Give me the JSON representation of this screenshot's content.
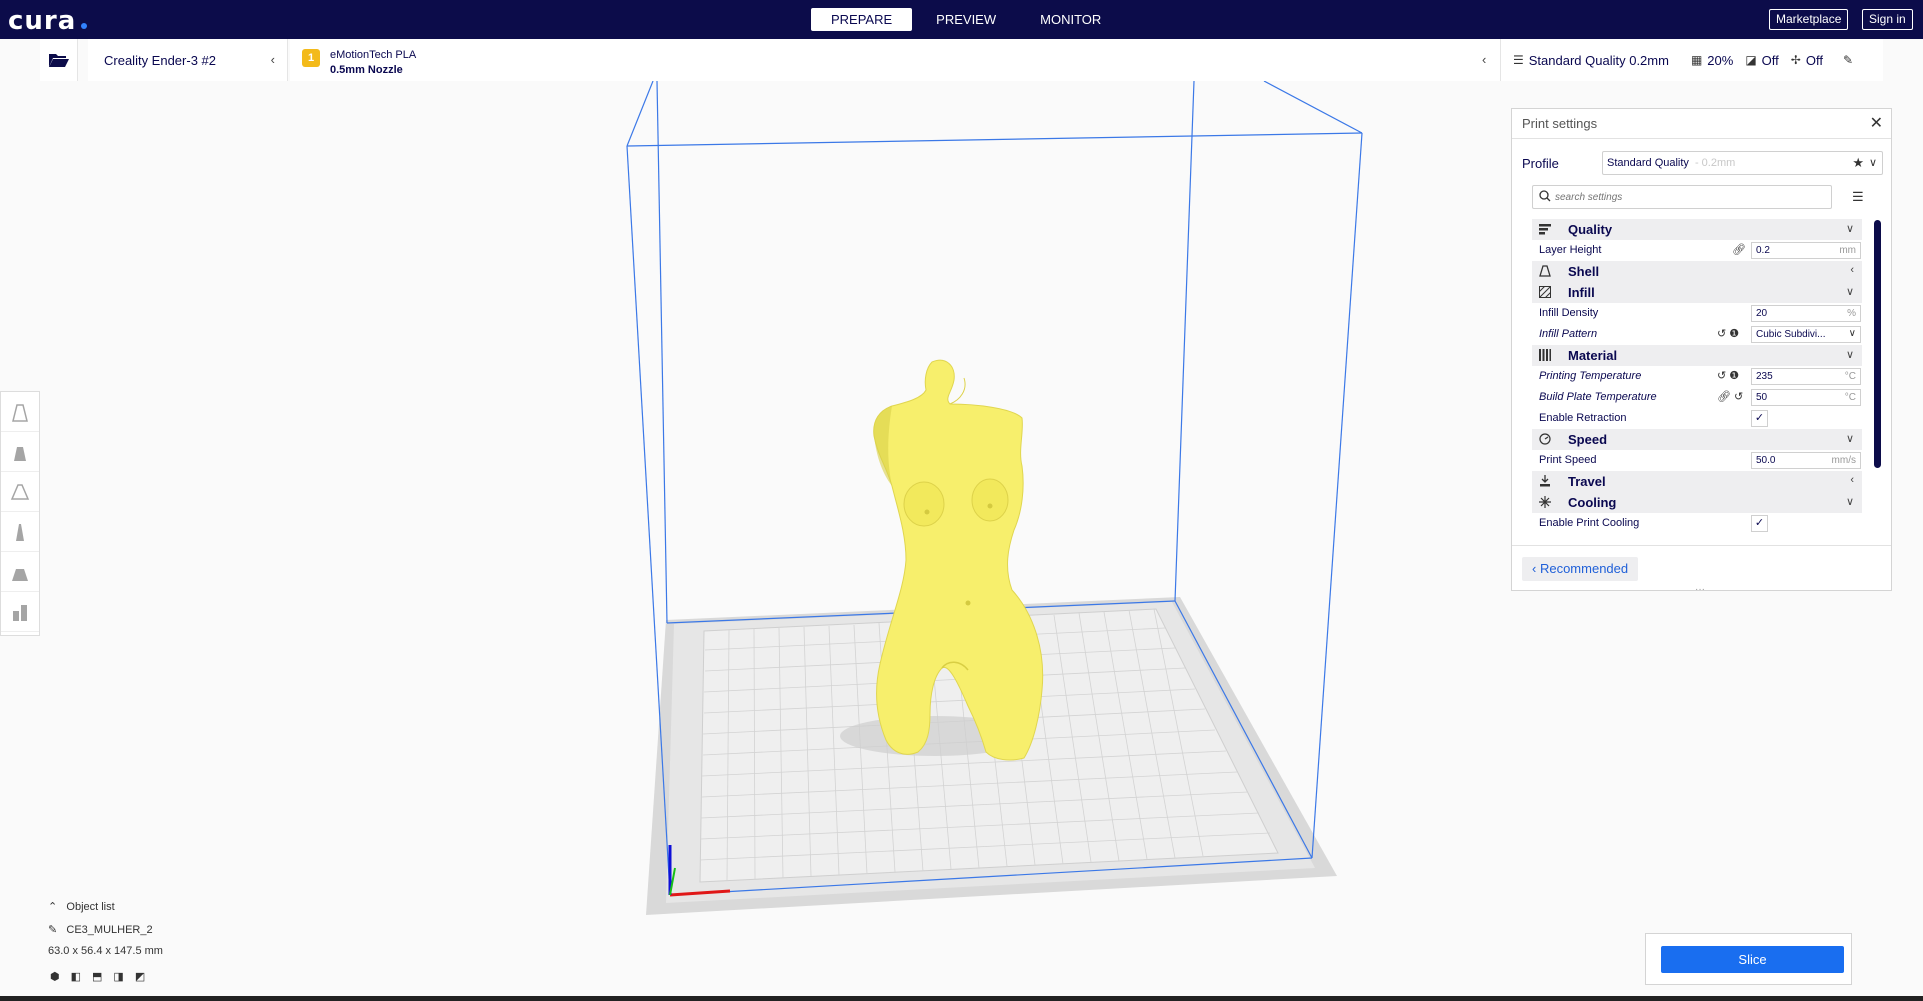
{
  "app": {
    "logo": "cura"
  },
  "stages": [
    {
      "label": "PREPARE",
      "active": true
    },
    {
      "label": "PREVIEW",
      "active": false
    },
    {
      "label": "MONITOR",
      "active": false
    }
  ],
  "topbar": {
    "marketplace": "Marketplace",
    "signin": "Sign in"
  },
  "header": {
    "printer": "Creality Ender-3 #2",
    "material_badge": "1",
    "material": "eMotionTech PLA",
    "nozzle": "0.5mm Nozzle",
    "quality": "Standard Quality 0.2mm",
    "infill": "20%",
    "support": "Off",
    "adhesion": "Off"
  },
  "panel": {
    "title": "Print settings",
    "profile_label": "Profile",
    "profile_value": "Standard Quality",
    "profile_suffix": "- 0.2mm",
    "search_placeholder": "search settings",
    "recommended": "Recommended",
    "categories": {
      "quality": "Quality",
      "shell": "Shell",
      "infill": "Infill",
      "material": "Material",
      "speed": "Speed",
      "travel": "Travel",
      "cooling": "Cooling"
    },
    "settings": {
      "layer_height": {
        "label": "Layer Height",
        "value": "0.2",
        "unit": "mm"
      },
      "infill_density": {
        "label": "Infill Density",
        "value": "20",
        "unit": "%"
      },
      "infill_pattern": {
        "label": "Infill Pattern",
        "value": "Cubic Subdivi..."
      },
      "print_temp": {
        "label": "Printing Temperature",
        "value": "235",
        "unit": "°C"
      },
      "bed_temp": {
        "label": "Build Plate Temperature",
        "value": "50",
        "unit": "°C"
      },
      "retraction": {
        "label": "Enable Retraction"
      },
      "print_speed": {
        "label": "Print Speed",
        "value": "50.0",
        "unit": "mm/s"
      },
      "cooling": {
        "label": "Enable Print Cooling"
      }
    }
  },
  "object": {
    "list_label": "Object list",
    "name": "CE3_MULHER_2",
    "dimensions": "63.0 x 56.4 x 147.5 mm"
  },
  "slice": {
    "label": "Slice"
  },
  "colors": {
    "navy": "#0c0c4a",
    "accent": "#196ef0",
    "model": "#f7ef6c"
  }
}
